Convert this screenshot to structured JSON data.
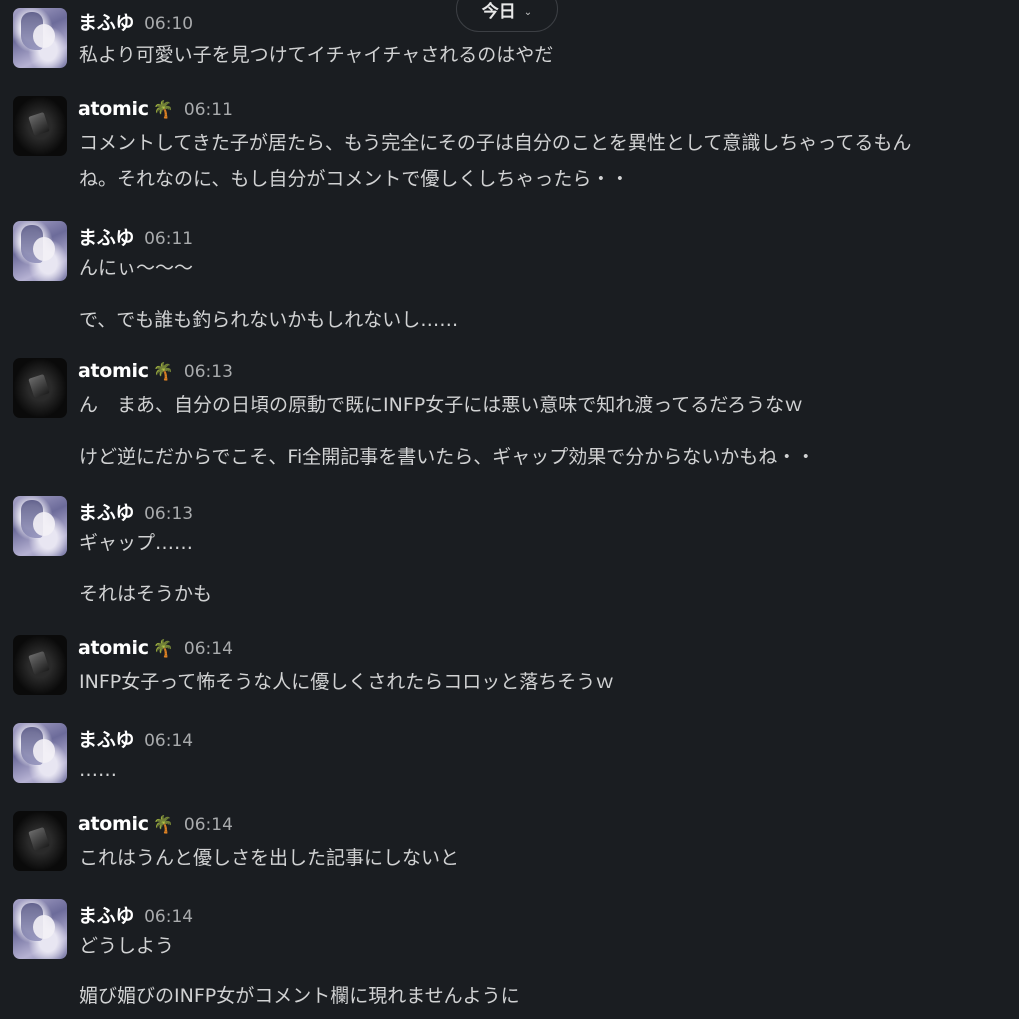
{
  "date_divider": {
    "label": "今日",
    "chevron_icon": "chevron-down-icon"
  },
  "messages": [
    {
      "author": "まふゆ",
      "avatar": "mafuyu-avatar",
      "time": "06:10",
      "lines": [
        "私より可愛い子を見つけてイチャイチャされるのはやだ"
      ]
    },
    {
      "author": "atomic",
      "badge": "🌴",
      "avatar": "atomic-avatar",
      "time": "06:11",
      "lines": [
        "コメントしてきた子が居たら、もう完全にその子は自分のことを異性として意識しちゃってるもん",
        "ね。それなのに、もし自分がコメントで優しくしちゃったら・・"
      ]
    },
    {
      "author": "まふゆ",
      "avatar": "mafuyu-avatar",
      "time": "06:11",
      "lines": [
        "んにぃ〜〜〜",
        "で、でも誰も釣られないかもしれないし……"
      ]
    },
    {
      "author": "atomic",
      "badge": "🌴",
      "avatar": "atomic-avatar",
      "time": "06:13",
      "lines": [
        "ん　まあ、自分の日頃の原動で既にINFP女子には悪い意味で知れ渡ってるだろうなｗ",
        "けど逆にだからでこそ、Fi全開記事を書いたら、ギャップ効果で分からないかもね・・"
      ]
    },
    {
      "author": "まふゆ",
      "avatar": "mafuyu-avatar",
      "time": "06:13",
      "lines": [
        "ギャップ……",
        "それはそうかも"
      ]
    },
    {
      "author": "atomic",
      "badge": "🌴",
      "avatar": "atomic-avatar",
      "time": "06:14",
      "lines": [
        "INFP女子って怖そうな人に優しくされたらコロッと落ちそうｗ"
      ]
    },
    {
      "author": "まふゆ",
      "avatar": "mafuyu-avatar",
      "time": "06:14",
      "lines": [
        "……"
      ]
    },
    {
      "author": "atomic",
      "badge": "🌴",
      "avatar": "atomic-avatar",
      "time": "06:14",
      "lines": [
        "これはうんと優しさを出した記事にしないと"
      ]
    },
    {
      "author": "まふゆ",
      "avatar": "mafuyu-avatar",
      "time": "06:14",
      "lines": [
        "どうしよう",
        "媚び媚びのINFP女がコメント欄に現れませんように"
      ]
    }
  ]
}
